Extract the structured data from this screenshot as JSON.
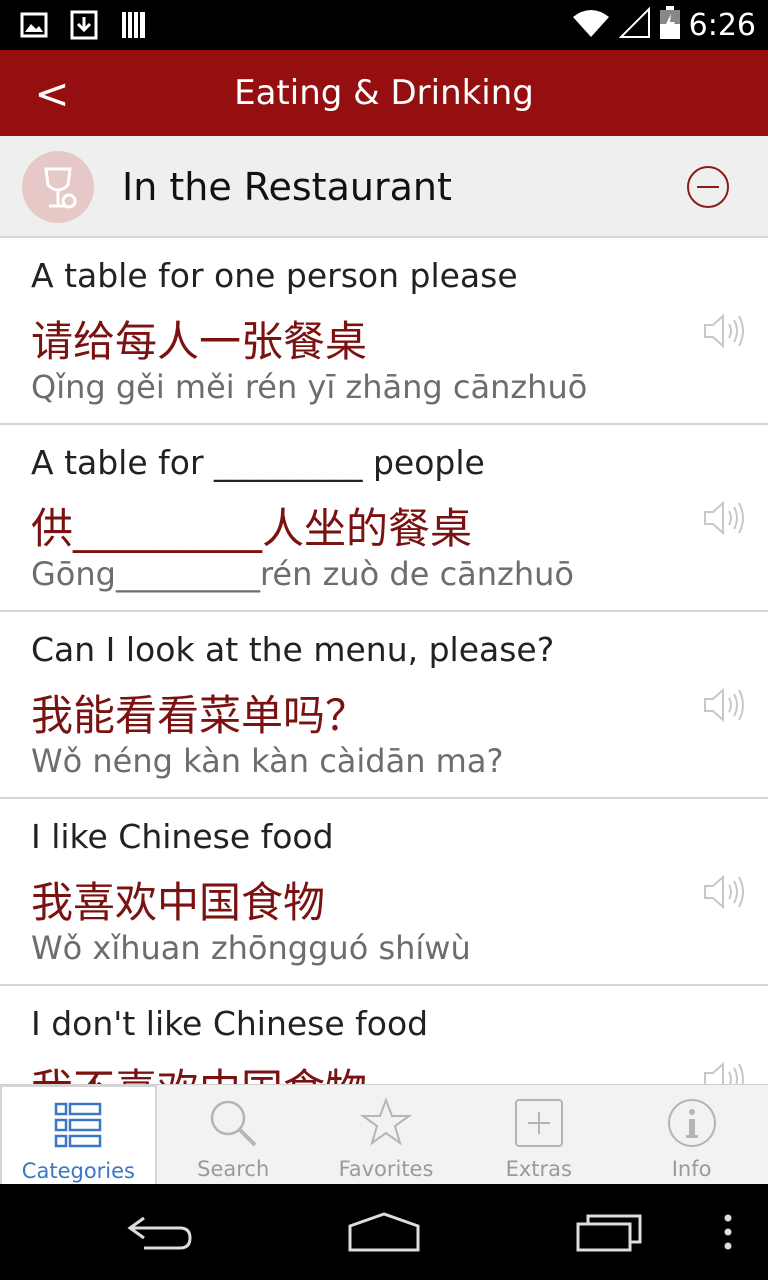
{
  "status_bar": {
    "time": "6:26"
  },
  "header": {
    "back_label": "<",
    "title": "Eating & Drinking"
  },
  "section": {
    "title": "In the Restaurant"
  },
  "phrases": [
    {
      "english": "A table for one person please",
      "chinese": "请给每人一张餐桌",
      "pinyin": "Qǐng gěi měi rén yī zhāng cānzhuō"
    },
    {
      "english": "A table for _________ people",
      "chinese": "供_________人坐的餐桌",
      "pinyin": "Gōng_________rén zuò de cānzhuō"
    },
    {
      "english": "Can I look at the menu, please?",
      "chinese": "我能看看菜单吗？",
      "pinyin": "Wǒ néng kàn kàn càidān ma?"
    },
    {
      "english": "I like Chinese food",
      "chinese": "我喜欢中国食物",
      "pinyin": "Wǒ xǐhuan zhōngguó shíwù"
    },
    {
      "english": "I don't like Chinese food",
      "chinese": "我不喜欢中国食物",
      "pinyin": ""
    }
  ],
  "tabs": [
    {
      "label": "Categories",
      "icon": "categories-icon",
      "active": true
    },
    {
      "label": "Search",
      "icon": "search-icon",
      "active": false
    },
    {
      "label": "Favorites",
      "icon": "star-icon",
      "active": false
    },
    {
      "label": "Extras",
      "icon": "plus-icon",
      "active": false
    },
    {
      "label": "Info",
      "icon": "info-icon",
      "active": false
    }
  ],
  "colors": {
    "header": "#950e10",
    "chinese_text": "#7a1212",
    "active_tab": "#3b77c4"
  }
}
